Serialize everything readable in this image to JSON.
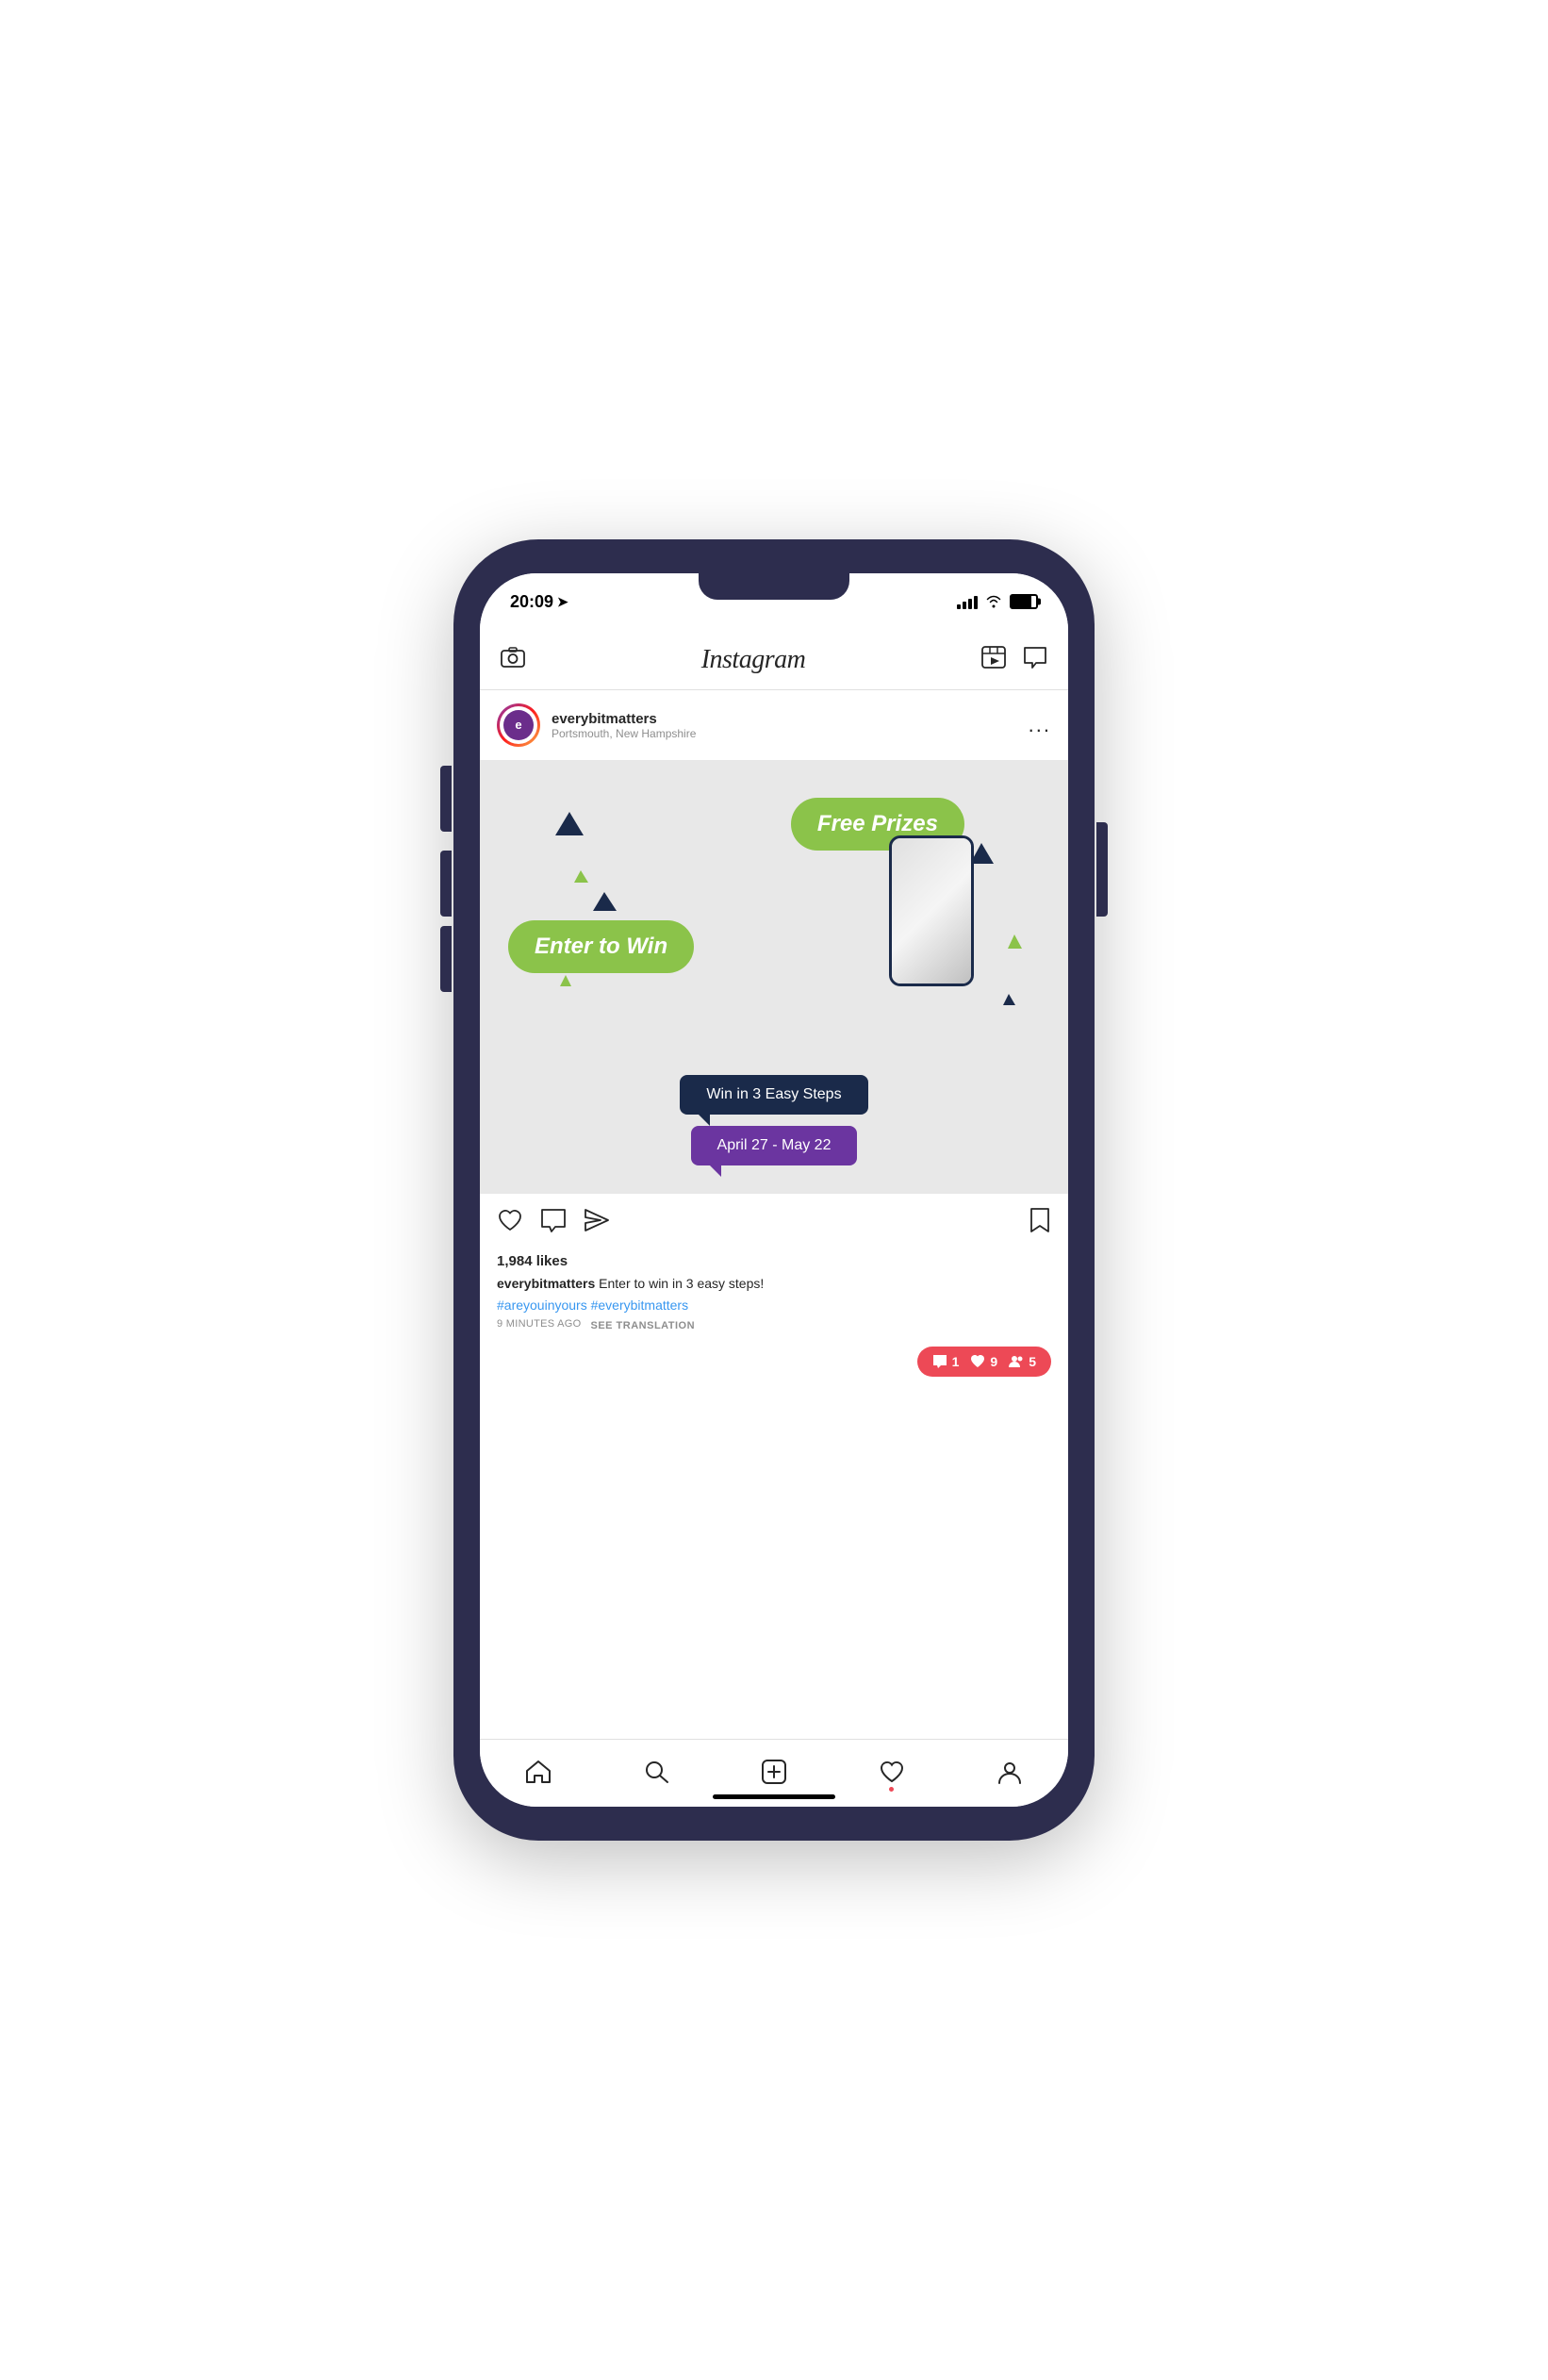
{
  "phone": {
    "status_bar": {
      "time": "20:09",
      "location_arrow": "▶",
      "signal": 4,
      "wifi": true,
      "battery": 80
    },
    "instagram_header": {
      "title": "Instagram",
      "camera_icon": "camera",
      "reels_icon": "reels",
      "messages_icon": "messages"
    },
    "post": {
      "username": "everybitmatters",
      "location": "Portsmouth, New Hampshire",
      "more_label": "...",
      "image": {
        "free_prizes_label": "Free Prizes",
        "enter_to_win_label": "Enter to Win",
        "steps_label": "Win in 3 Easy Steps",
        "date_label": "April 27 - May 22",
        "bg_color": "#e8e8e8",
        "blob_color": "#8bc34a",
        "dark_color": "#1a2a4a",
        "purple_color": "#6b35a0"
      },
      "likes": "1,984 likes",
      "caption_user": "everybitmatters",
      "caption_text": "Enter to win in 3 easy steps!",
      "hashtags": "#areyouinyours #everybitmatters",
      "time_ago": "9 MINUTES AGO",
      "see_translation": "SEE TRANSLATION"
    },
    "notifications": {
      "comment_count": "1",
      "likes_count": "9",
      "users_count": "5"
    },
    "bottom_nav": {
      "home": "home",
      "search": "search",
      "add": "add",
      "heart": "heart",
      "profile": "profile"
    }
  }
}
